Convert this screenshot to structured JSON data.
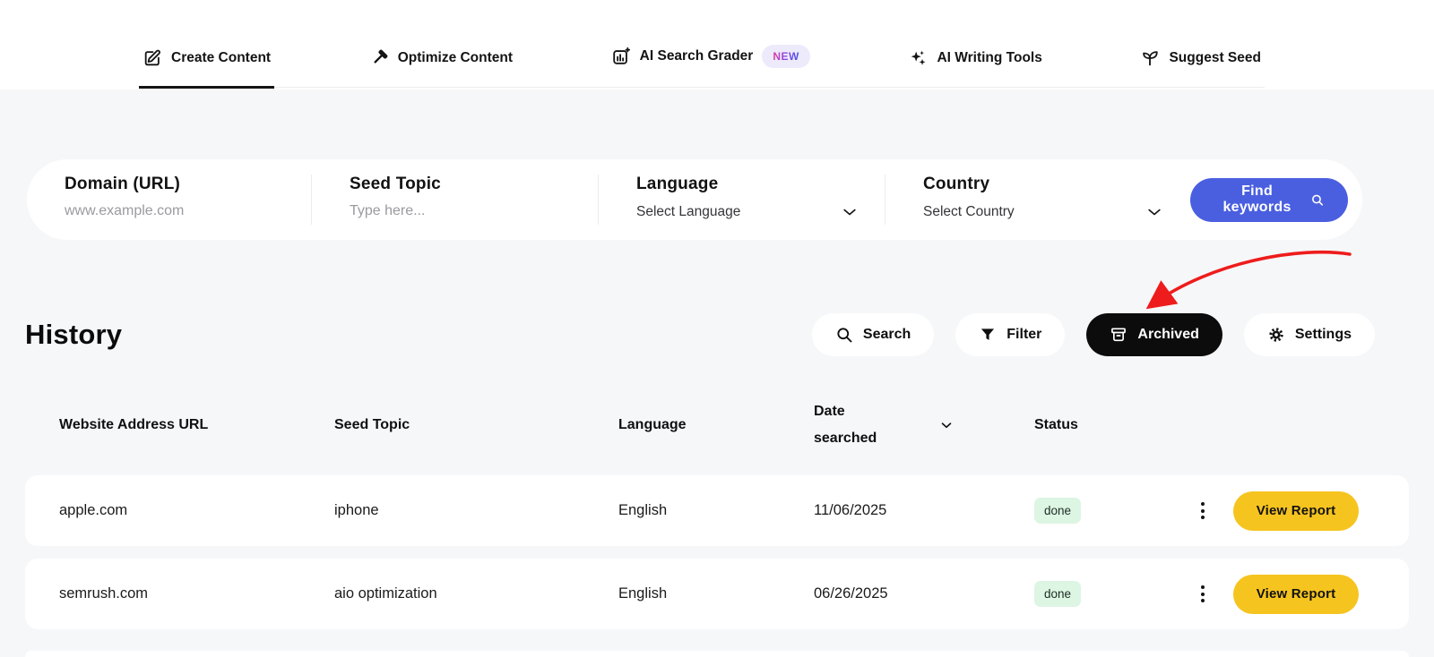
{
  "tabs": [
    {
      "label": "Create Content",
      "icon": "edit-icon",
      "active": true
    },
    {
      "label": "Optimize Content",
      "icon": "hammer-icon",
      "active": false
    },
    {
      "label": "AI Search Grader",
      "icon": "bar-chart-plus-icon",
      "active": false,
      "badge": "NEW"
    },
    {
      "label": "AI Writing Tools",
      "icon": "sparkles-icon",
      "active": false
    },
    {
      "label": "Suggest Seed",
      "icon": "seedling-icon",
      "active": false
    }
  ],
  "search_form": {
    "fields": [
      {
        "label": "Domain (URL)",
        "placeholder": "www.example.com",
        "type": "input"
      },
      {
        "label": "Seed Topic",
        "placeholder": "Type here...",
        "type": "input"
      },
      {
        "label": "Language",
        "value": "Select Language",
        "type": "select",
        "icon": "chevron-down-icon"
      },
      {
        "label": "Country",
        "value": "Select Country",
        "type": "select",
        "icon": "chevron-down-icon"
      }
    ],
    "submit_label": "Find keywords",
    "submit_icon": "search-icon"
  },
  "history": {
    "title": "History",
    "actions": [
      {
        "label": "Search",
        "icon": "search-icon",
        "active": false
      },
      {
        "label": "Filter",
        "icon": "filter-icon",
        "active": false
      },
      {
        "label": "Archived",
        "icon": "archive-icon",
        "active": true
      },
      {
        "label": "Settings",
        "icon": "gear-icon",
        "active": false
      }
    ],
    "table": {
      "columns": {
        "c1": "Website Address URL",
        "c2": "Seed Topic",
        "c3": "Language",
        "c4": "Date searched",
        "c5": "Status"
      },
      "sort_icon": "chevron-down-icon",
      "rows": [
        {
          "url": "apple.com",
          "seed_topic": "iphone",
          "language": "English",
          "date": "11/06/2025",
          "status": "done",
          "action": "View Report"
        },
        {
          "url": "semrush.com",
          "seed_topic": "aio optimization",
          "language": "English",
          "date": "06/26/2025",
          "status": "done",
          "action": "View Report"
        }
      ]
    }
  },
  "annotation": {
    "shape": "red-curved-arrow",
    "points_to": "Archived button",
    "color": "#ee1c1c"
  },
  "colors": {
    "accent_blue": "#4a5fe0",
    "accent_yellow": "#f6c41f",
    "status_done_bg": "#ddf5e3",
    "badge_new_bg": "#edeafb",
    "page_bg": "#f6f7f9",
    "card_bg": "#ffffff",
    "dark_pill": "#0c0c0c"
  }
}
